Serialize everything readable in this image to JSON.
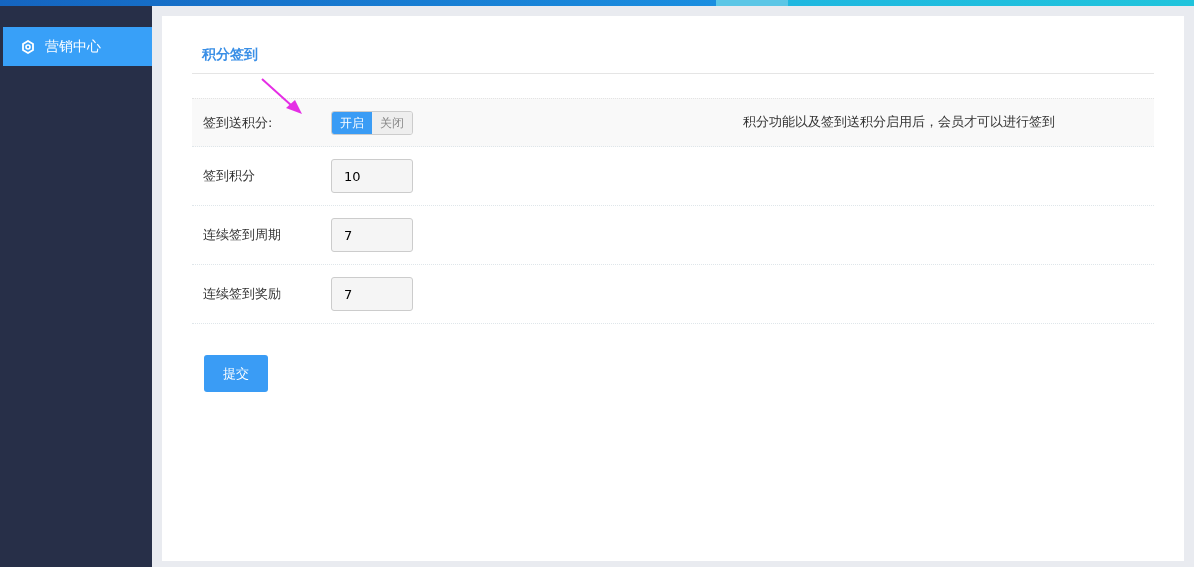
{
  "sidebar": {
    "items": [
      {
        "label": "营销中心",
        "selected": true
      }
    ]
  },
  "panel": {
    "title": "积分签到",
    "rows": [
      {
        "kind": "toggle",
        "label": "签到送积分:",
        "options": [
          {
            "label": "开启",
            "selected": true
          },
          {
            "label": "关闭",
            "selected": false
          }
        ],
        "hint": "积分功能以及签到送积分启用后，会员才可以进行签到"
      },
      {
        "kind": "input",
        "label": "签到积分",
        "value": "10"
      },
      {
        "kind": "input",
        "label": "连续签到周期",
        "value": "7"
      },
      {
        "kind": "input",
        "label": "连续签到奖励",
        "value": "7"
      }
    ],
    "submit": "提交"
  }
}
